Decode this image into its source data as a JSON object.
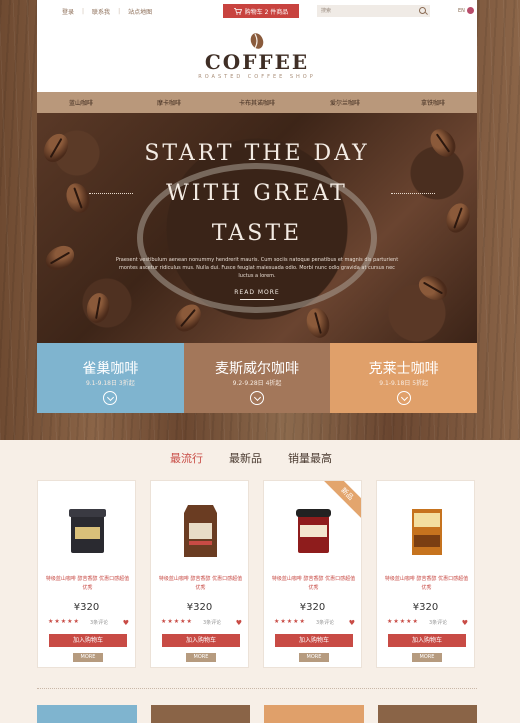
{
  "topbar": {
    "links": [
      "登录",
      "联系我",
      "站点地图"
    ],
    "cart_label": "购物车 2 件商品",
    "search_placeholder": "搜索",
    "lang": "EN"
  },
  "logo": {
    "title": "COFFEE",
    "subtitle": "ROASTED COFFEE SHOP"
  },
  "nav": [
    "蓝山咖啡",
    "摩卡咖啡",
    "卡布其诺咖啡",
    "爱尔兰咖啡",
    "拿铁咖啡"
  ],
  "hero": {
    "line1": "START THE DAY",
    "line2": "WITH GREAT",
    "line3": "TASTE",
    "body": "Praesent vestibulum aenean nonummy hendrerit mauris. Cum sociis natoque penatibus et magnis dis parturient montes ascetur ridiculus mus. Nulla dui. Fusce feugiat malesuada odio. Morbi nunc odio gravida at cursus nec luctus a lorem.",
    "read_more": "READ MORE"
  },
  "features": [
    {
      "name": "雀巢咖啡",
      "date": "9.1-9.18日 3折起",
      "color": "#7fb4cf"
    },
    {
      "name": "麦斯威尔咖啡",
      "date": "9.2-9.28日 4折起",
      "color": "#a3775a"
    },
    {
      "name": "克莱士咖啡",
      "date": "9.1-9.18日 5折起",
      "color": "#e0a06a"
    }
  ],
  "tabs": [
    "最流行",
    "最新品",
    "销量最高"
  ],
  "products": [
    {
      "name": "特级蓝山咖啡 醇苦香醇 优惠口感超值优秀",
      "price": "¥320",
      "stars": "★★★★★",
      "reviews": "3条评论",
      "add_label": "加入购物车",
      "more_label": "MORE",
      "ribbon": ""
    },
    {
      "name": "特级蓝山咖啡 醇苦香醇 优惠口感超值优秀",
      "price": "¥320",
      "stars": "★★★★★",
      "reviews": "3条评论",
      "add_label": "加入购物车",
      "more_label": "MORE",
      "ribbon": ""
    },
    {
      "name": "特级蓝山咖啡 醇苦香醇 优惠口感超值优秀",
      "price": "¥320",
      "stars": "★★★★★",
      "reviews": "3条评论",
      "add_label": "加入购物车",
      "more_label": "MORE",
      "ribbon": "新品"
    },
    {
      "name": "特级蓝山咖啡 醇苦香醇 优惠口感超值优秀",
      "price": "¥320",
      "stars": "★★★★★",
      "reviews": "3条评论",
      "add_label": "加入购物车",
      "more_label": "MORE",
      "ribbon": ""
    }
  ],
  "colors": {
    "accent": "#c84b45",
    "nav": "#b9987b",
    "blue": "#7fb4cf",
    "brown": "#a3775a",
    "orange": "#e0a06a"
  }
}
